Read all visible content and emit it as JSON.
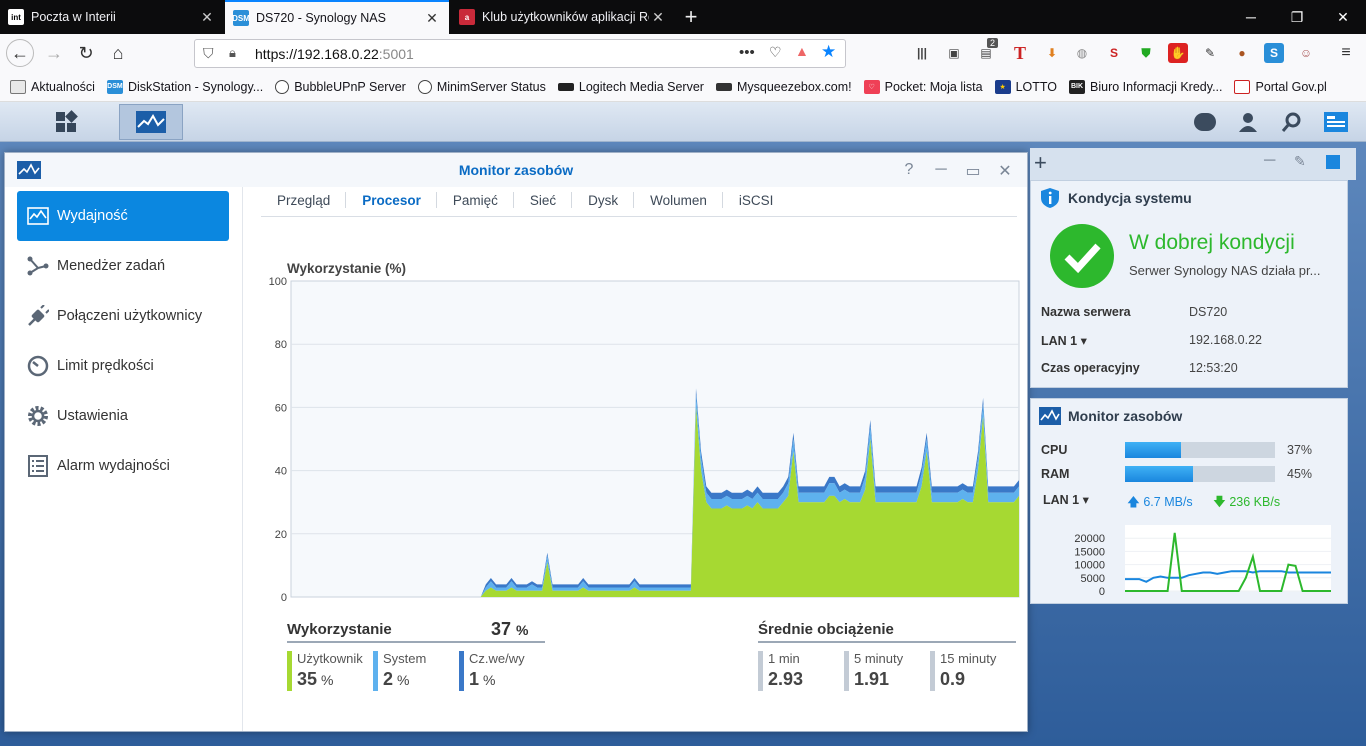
{
  "browser": {
    "tabs": [
      {
        "title": "Poczta w Interii",
        "favicon": "int"
      },
      {
        "title": "DS720 - Synology NAS",
        "favicon": "DSM"
      },
      {
        "title": "Klub użytkowników aplikacji Ro",
        "favicon": "a"
      }
    ],
    "url_host": "https://192.168.0.22",
    "url_port": ":5001",
    "bookmarks": [
      "Aktualności",
      "DiskStation - Synology...",
      "BubbleUPnP Server",
      "MinimServer Status",
      "Logitech Media Server",
      "Mysqueezebox.com!",
      "Pocket: Moja lista",
      "LOTTO",
      "Biuro Informacji Kredy...",
      "Portal Gov.pl"
    ],
    "badge_count": "2"
  },
  "window": {
    "title": "Monitor zasobów",
    "sidebar": [
      {
        "label": "Wydajność",
        "icon": "performance-icon"
      },
      {
        "label": "Menedżer zadań",
        "icon": "task-manager-icon"
      },
      {
        "label": "Połączeni użytkownicy",
        "icon": "plug-icon"
      },
      {
        "label": "Limit prędkości",
        "icon": "speedometer-icon"
      },
      {
        "label": "Ustawienia",
        "icon": "gear-icon"
      },
      {
        "label": "Alarm wydajności",
        "icon": "list-icon"
      }
    ],
    "tabs": [
      "Przegląd",
      "Procesor",
      "Pamięć",
      "Sieć",
      "Dysk",
      "Wolumen",
      "iSCSI"
    ],
    "active_tab": "Procesor",
    "chart_title": "Wykorzystanie (%)",
    "usage": {
      "title": "Wykorzystanie",
      "total": "37",
      "unit": "%",
      "items": [
        {
          "label": "Użytkownik",
          "value": "35",
          "unit": "%",
          "color": "#a6d932"
        },
        {
          "label": "System",
          "value": "2",
          "unit": "%",
          "color": "#5eb1ee"
        },
        {
          "label": "Cz.we/wy",
          "value": "1",
          "unit": "%",
          "color": "#3a78c8"
        }
      ]
    },
    "load": {
      "title": "Średnie obciążenie",
      "items": [
        {
          "label": "1 min",
          "value": "2.93"
        },
        {
          "label": "5 minuty",
          "value": "1.91"
        },
        {
          "label": "15 minuty",
          "value": "0.9"
        }
      ]
    }
  },
  "health": {
    "title": "Kondycja systemu",
    "status": "W dobrej kondycji",
    "desc": "Serwer Synology NAS działa pr...",
    "rows": [
      {
        "key": "Nazwa serwera",
        "value": "DS720"
      },
      {
        "key": "LAN 1 ▾",
        "value": "192.168.0.22"
      },
      {
        "key": "Czas operacyjny",
        "value": "12:53:20"
      }
    ]
  },
  "monitor_widget": {
    "title": "Monitor zasobów",
    "cpu_label": "CPU",
    "cpu_value": "37%",
    "cpu_pct": 37,
    "ram_label": "RAM",
    "ram_value": "45%",
    "ram_pct": 45,
    "lan_label": "LAN 1 ▾",
    "up": "6.7 MB/s",
    "down": "236 KB/s",
    "y_ticks": [
      "20000",
      "15000",
      "10000",
      "5000",
      "0"
    ]
  },
  "chart_data": [
    {
      "type": "area",
      "title": "Wykorzystanie (%)",
      "ylim": [
        0,
        100
      ],
      "y_ticks": [
        0,
        20,
        40,
        60,
        80,
        100
      ],
      "grid": true,
      "series": [
        {
          "name": "Użytkownik",
          "color": "#a6d932",
          "values": [
            0,
            0,
            0,
            0,
            0,
            0,
            0,
            0,
            0,
            0,
            0,
            0,
            0,
            0,
            0,
            0,
            0,
            0,
            0,
            0,
            0,
            0,
            0,
            0,
            0,
            0,
            0,
            0,
            0,
            0,
            0,
            0,
            0,
            0,
            0,
            0,
            0,
            0,
            2,
            3,
            2,
            2,
            2,
            3,
            2,
            2,
            2,
            2,
            2,
            2,
            11,
            2,
            2,
            2,
            2,
            2,
            2,
            3,
            2,
            2,
            2,
            2,
            2,
            2,
            2,
            2,
            2,
            3,
            2,
            2,
            2,
            2,
            2,
            2,
            2,
            2,
            2,
            2,
            2,
            60,
            40,
            30,
            28,
            28,
            28,
            29,
            28,
            28,
            28,
            29,
            28,
            30,
            28,
            28,
            28,
            28,
            30,
            32,
            46,
            30,
            30,
            30,
            30,
            30,
            30,
            32,
            32,
            30,
            31,
            30,
            30,
            30,
            34,
            50,
            30,
            30,
            30,
            30,
            30,
            30,
            30,
            30,
            30,
            35,
            46,
            30,
            30,
            30,
            30,
            30,
            30,
            31,
            30,
            30,
            40,
            57,
            30,
            30,
            30,
            30,
            30,
            30,
            32
          ],
          "comment": null
        },
        {
          "name": "System",
          "color": "#5eb1ee",
          "values": [
            0,
            0,
            0,
            0,
            0,
            0,
            0,
            0,
            0,
            0,
            0,
            0,
            0,
            0,
            0,
            0,
            0,
            0,
            0,
            0,
            0,
            0,
            0,
            0,
            0,
            0,
            0,
            0,
            0,
            0,
            0,
            0,
            0,
            0,
            0,
            0,
            0,
            0,
            1,
            2,
            1,
            1,
            1,
            2,
            1,
            1,
            1,
            2,
            1,
            1,
            2,
            1,
            1,
            1,
            1,
            1,
            1,
            2,
            1,
            1,
            1,
            1,
            1,
            1,
            1,
            1,
            1,
            2,
            1,
            1,
            1,
            1,
            1,
            1,
            1,
            1,
            1,
            1,
            1,
            4,
            4,
            3,
            3,
            3,
            3,
            3,
            3,
            3,
            3,
            3,
            3,
            3,
            3,
            3,
            3,
            3,
            3,
            4,
            4,
            3,
            3,
            3,
            3,
            3,
            3,
            4,
            4,
            3,
            3,
            3,
            3,
            3,
            4,
            4,
            3,
            3,
            3,
            3,
            3,
            3,
            3,
            3,
            3,
            4,
            4,
            3,
            3,
            3,
            3,
            3,
            3,
            3,
            3,
            3,
            4,
            4,
            3,
            3,
            3,
            3,
            3,
            3,
            3
          ]
        },
        {
          "name": "Cz.we/wy",
          "color": "#3a78c8",
          "values": [
            0,
            0,
            0,
            0,
            0,
            0,
            0,
            0,
            0,
            0,
            0,
            0,
            0,
            0,
            0,
            0,
            0,
            0,
            0,
            0,
            0,
            0,
            0,
            0,
            0,
            0,
            0,
            0,
            0,
            0,
            0,
            0,
            0,
            0,
            0,
            0,
            0,
            0,
            1,
            1,
            1,
            1,
            1,
            1,
            1,
            1,
            1,
            1,
            1,
            1,
            1,
            1,
            1,
            1,
            1,
            1,
            1,
            1,
            1,
            1,
            1,
            1,
            1,
            1,
            1,
            1,
            1,
            1,
            1,
            1,
            1,
            1,
            1,
            1,
            1,
            1,
            1,
            1,
            1,
            2,
            2,
            2,
            2,
            2,
            2,
            2,
            2,
            2,
            2,
            2,
            2,
            2,
            2,
            2,
            2,
            2,
            2,
            2,
            2,
            2,
            2,
            2,
            2,
            2,
            2,
            2,
            2,
            2,
            2,
            2,
            2,
            2,
            2,
            2,
            2,
            2,
            2,
            2,
            2,
            2,
            2,
            2,
            2,
            2,
            2,
            2,
            2,
            2,
            2,
            2,
            2,
            2,
            2,
            2,
            2,
            2,
            2,
            2,
            2,
            2,
            2,
            2,
            2
          ]
        }
      ]
    },
    {
      "type": "line",
      "ylim": [
        0,
        25000
      ],
      "y_ticks": [
        0,
        5000,
        10000,
        15000,
        20000
      ],
      "series": [
        {
          "name": "upload",
          "color": "#1a86de",
          "values": [
            4500,
            4500,
            4500,
            3500,
            5000,
            5500,
            5000,
            5000,
            5000,
            6000,
            6500,
            7000,
            7000,
            6500,
            7000,
            7500,
            7500,
            7500,
            7000,
            7500,
            7500,
            7500,
            7500,
            7000,
            7000,
            7000,
            7000,
            7000,
            7000,
            7000
          ]
        },
        {
          "name": "download",
          "color": "#2db82d",
          "values": [
            0,
            0,
            0,
            0,
            0,
            0,
            0,
            22000,
            0,
            0,
            0,
            0,
            0,
            0,
            0,
            0,
            0,
            5000,
            13000,
            0,
            0,
            0,
            0,
            10000,
            9500,
            0,
            0,
            0,
            0,
            0
          ]
        }
      ]
    }
  ]
}
